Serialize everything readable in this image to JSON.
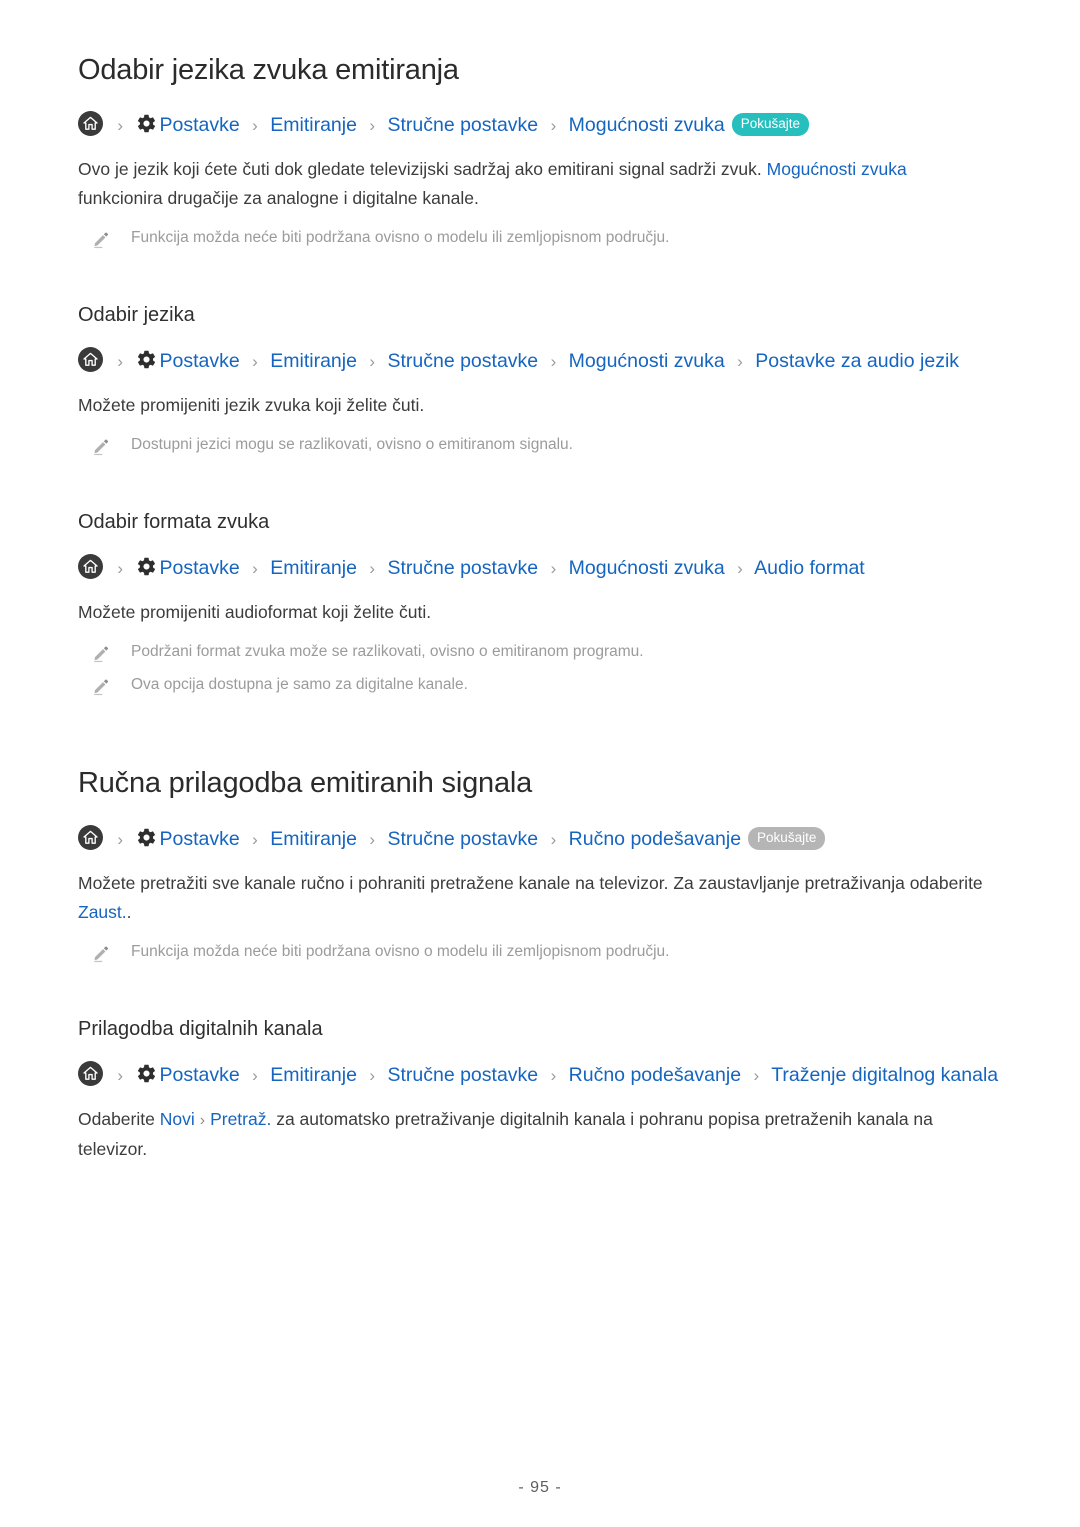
{
  "document": {
    "page_number": "- 95 -"
  },
  "icons": {
    "home": "home-icon",
    "gear": "gear-icon",
    "pencil": "pencil-icon",
    "separator": "chevron-right-icon"
  },
  "colors": {
    "link_blue": "#1565c0",
    "badge_teal": "#27bfbd",
    "badge_gray": "#b5b5b5",
    "note_gray": "#9b9b9b",
    "body_text": "#3c3c3c",
    "heading": "#2b2b2b"
  },
  "separator": ">",
  "sections": [
    {
      "id": "odabir-jezika-zvuka-emitiranja",
      "level": "h1",
      "title": "Odabir jezika zvuka emitiranja",
      "breadcrumb": {
        "crumbs": [
          "Postavke",
          "Emitiranje",
          "Stručne postavke",
          "Mogućnosti zvuka"
        ],
        "badge": {
          "label": "Pokušajte",
          "style": "teal"
        }
      },
      "paragraph": {
        "pre": "Ovo je jezik koji ćete čuti dok gledate televizijski sadržaj ako emitirani signal sadrži zvuk. ",
        "link": "Mogućnosti zvuka",
        "post": " funkcionira drugačije za analogne i digitalne kanale."
      },
      "notes": [
        "Funkcija možda neće biti podržana ovisno o modelu ili zemljopisnom području."
      ]
    },
    {
      "id": "odabir-jezika",
      "level": "h2",
      "title": "Odabir jezika",
      "breadcrumb": {
        "crumbs": [
          "Postavke",
          "Emitiranje",
          "Stručne postavke",
          "Mogućnosti zvuka",
          "Postavke za audio jezik"
        ],
        "badge": null
      },
      "paragraph": {
        "pre": "Možete promijeniti jezik zvuka koji želite čuti.",
        "link": "",
        "post": ""
      },
      "notes": [
        "Dostupni jezici mogu se razlikovati, ovisno o emitiranom signalu."
      ]
    },
    {
      "id": "odabir-formata-zvuka",
      "level": "h2",
      "title": "Odabir formata zvuka",
      "breadcrumb": {
        "crumbs": [
          "Postavke",
          "Emitiranje",
          "Stručne postavke",
          "Mogućnosti zvuka",
          "Audio format"
        ],
        "badge": null
      },
      "paragraph": {
        "pre": "Možete promijeniti audioformat koji želite čuti.",
        "link": "",
        "post": ""
      },
      "notes": [
        "Podržani format zvuka može se razlikovati, ovisno o emitiranom programu.",
        "Ova opcija dostupna je samo za digitalne kanale."
      ]
    },
    {
      "id": "rucna-prilagodba-emitiranih-signala",
      "level": "h1",
      "title": "Ručna prilagodba emitiranih signala",
      "breadcrumb": {
        "crumbs": [
          "Postavke",
          "Emitiranje",
          "Stručne postavke",
          "Ručno podešavanje"
        ],
        "badge": {
          "label": "Pokušajte",
          "style": "gray"
        }
      },
      "paragraph": {
        "pre": "Možete pretražiti sve kanale ručno i pohraniti pretražene kanale na televizor. Za zaustavljanje pretraživanja odaberite ",
        "link": "Zaust.",
        "post": "."
      },
      "notes": [
        "Funkcija možda neće biti podržana ovisno o modelu ili zemljopisnom području."
      ]
    },
    {
      "id": "prilagodba-digitalnih-kanala",
      "level": "h2",
      "title": "Prilagodba digitalnih kanala",
      "breadcrumb": {
        "crumbs": [
          "Postavke",
          "Emitiranje",
          "Stručne postavke",
          "Ručno podešavanje",
          "Traženje digitalnog kanala"
        ],
        "badge": null
      },
      "paragraph": {
        "pre": "Odaberite ",
        "link": "Novi",
        "link2": "Pretraž.",
        "post": " za automatsko pretraživanje digitalnih kanala i pohranu popisa pretraženih kanala na televizor."
      },
      "notes": []
    }
  ]
}
